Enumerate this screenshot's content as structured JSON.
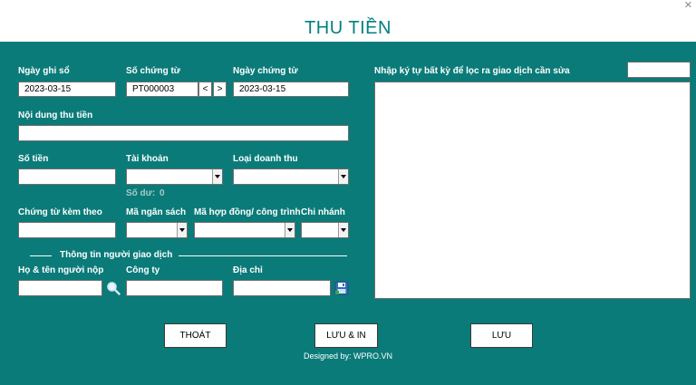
{
  "window": {
    "close_glyph": "✕"
  },
  "header": {
    "title": "THU TIỀN"
  },
  "form": {
    "ngay_ghi_so": {
      "label": "Ngày ghi sổ",
      "value": "2023-03-15"
    },
    "so_chung_tu": {
      "label": "Số chứng từ",
      "value": "PT000003",
      "prev_label": "<",
      "next_label": ">"
    },
    "ngay_chung_tu": {
      "label": "Ngày chứng từ",
      "value": "2023-03-15"
    },
    "noi_dung": {
      "label": "Nội dung thu tiền",
      "value": ""
    },
    "so_tien": {
      "label": "Số tiền",
      "value": ""
    },
    "tai_khoan": {
      "label": "Tài khoản",
      "value": ""
    },
    "so_du": {
      "label": "Số dư:",
      "value": "0"
    },
    "loai_doanh_thu": {
      "label": "Loại doanh thu",
      "value": ""
    },
    "chung_tu_kem_theo": {
      "label": "Chứng từ kèm theo",
      "value": ""
    },
    "ma_ngan_sach": {
      "label": "Mã ngân sách",
      "value": ""
    },
    "ma_hop_dong": {
      "label": "Mã hợp đồng/ công trình",
      "value": ""
    },
    "chi_nhanh": {
      "label": "Chi nhánh",
      "value": ""
    },
    "section_payer": "Thông tin người giao dịch",
    "ho_ten": {
      "label": "Họ & tên người nộp",
      "value": ""
    },
    "cong_ty": {
      "label": "Công ty",
      "value": ""
    },
    "dia_chi": {
      "label": "Địa chỉ",
      "value": ""
    }
  },
  "filter": {
    "label": "Nhập ký tự bất kỳ để lọc ra giao dịch cần sửa",
    "value": ""
  },
  "buttons": {
    "exit": "THOÁT",
    "save_print": "LƯU & IN",
    "save": "LƯU"
  },
  "footer": {
    "text": "Designed by: WPRO.VN"
  },
  "icons": {
    "search": "magnifier-icon",
    "save": "floppy-disk-icon"
  },
  "colors": {
    "panel": "#0a7b79",
    "title": "#008080"
  }
}
